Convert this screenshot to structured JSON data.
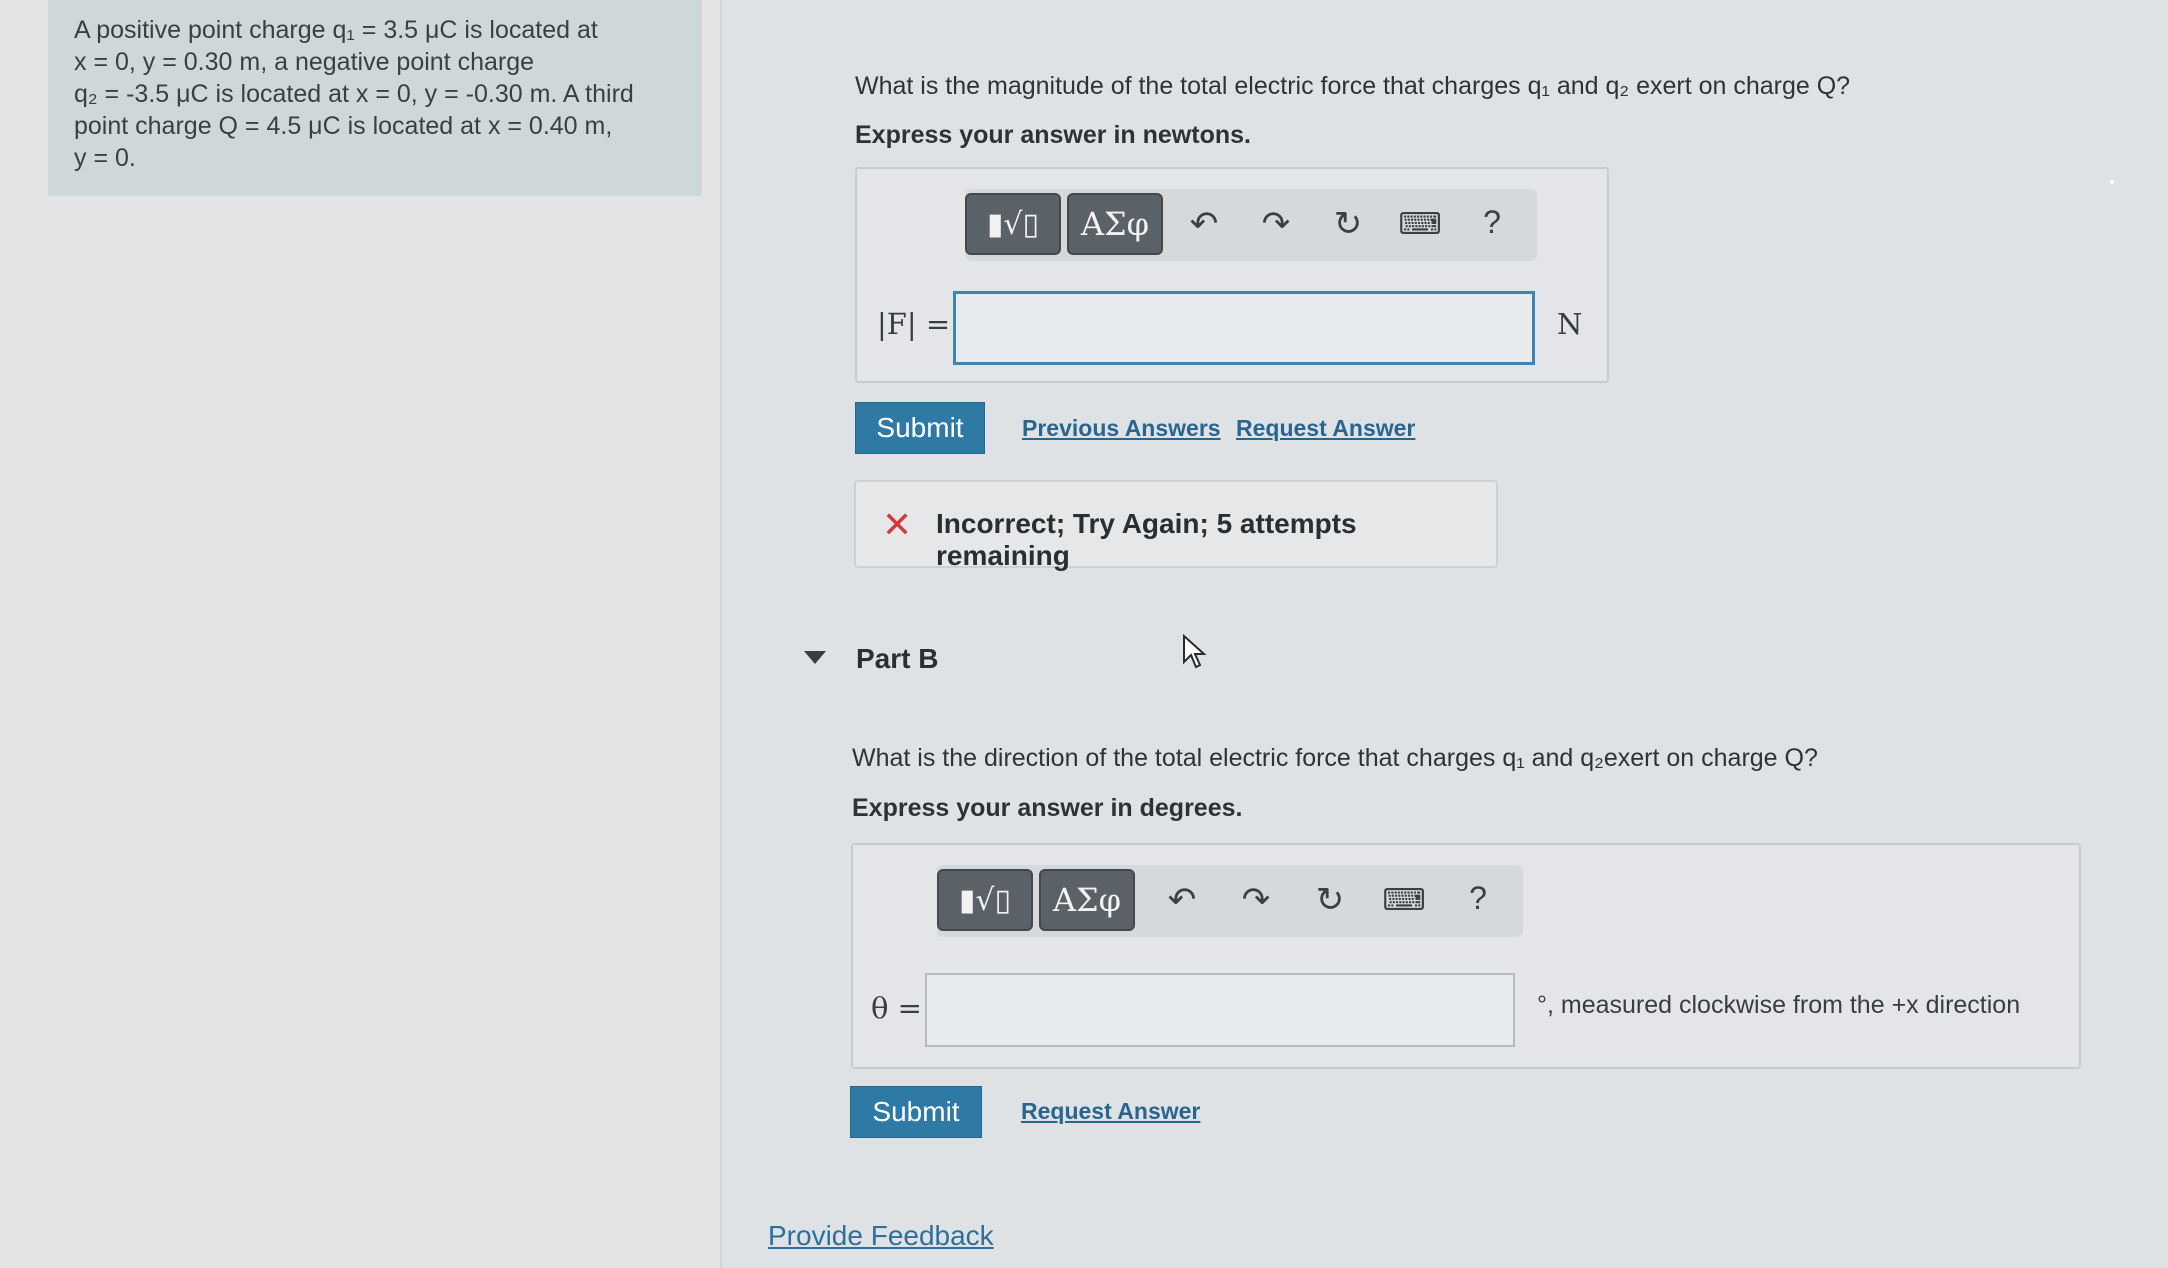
{
  "problem": {
    "lines": [
      "A positive point charge q₁ = 3.5 μC is located at",
      "x = 0, y = 0.30 m, a negative point charge",
      "q₂ = -3.5 μC is located at x = 0, y = -0.30 m. A third",
      "point charge Q = 4.5 μC is located at x = 0.40 m,",
      "y = 0."
    ]
  },
  "part_a": {
    "question": "What is the magnitude of the total electric force that charges q₁ and q₂ exert on charge Q?",
    "instruction": "Express your answer in newtons.",
    "toolbar": {
      "templates": "▮√▯",
      "greek": "ΑΣφ",
      "undo": "↶",
      "redo": "↷",
      "reset": "↻",
      "keyboard": "⌨",
      "help": "?"
    },
    "variable_label": "|F| =",
    "input_value": "",
    "unit": "N",
    "submit_label": "Submit",
    "previous_answers_label": "Previous Answers",
    "request_answer_label": "Request Answer",
    "feedback": "Incorrect; Try Again; 5 attempts remaining"
  },
  "part_b": {
    "title": "Part B",
    "question": "What is the direction of the total electric force that charges q₁ and q₂exert on charge Q?",
    "instruction": "Express your answer in degrees.",
    "toolbar": {
      "templates": "▮√▯",
      "greek": "ΑΣφ",
      "undo": "↶",
      "redo": "↷",
      "reset": "↻",
      "keyboard": "⌨",
      "help": "?"
    },
    "variable_label": "θ =",
    "input_value": "",
    "unit": "°, measured clockwise from the +x direction",
    "submit_label": "Submit",
    "request_answer_label": "Request Answer"
  },
  "provide_feedback_label": "Provide Feedback"
}
